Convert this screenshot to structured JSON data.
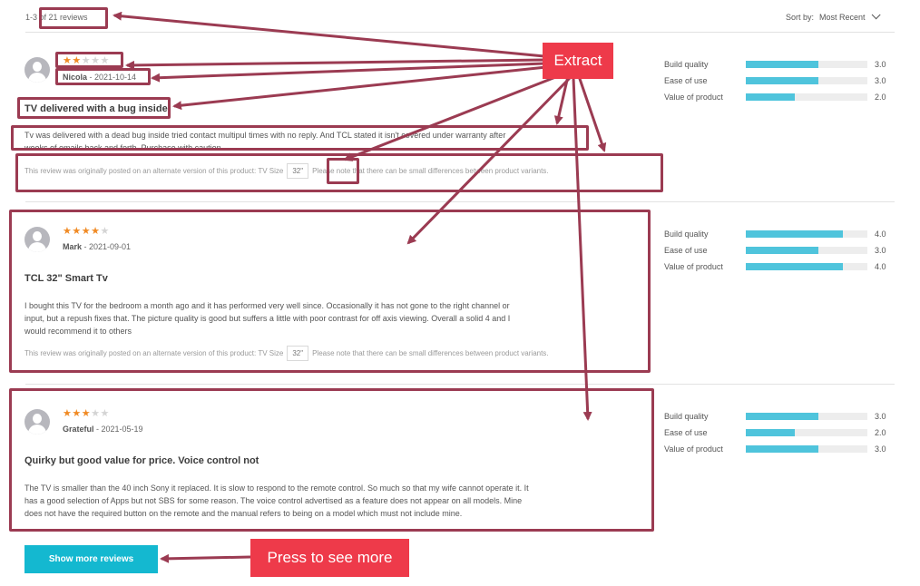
{
  "header": {
    "count": "1-3 of 21 reviews",
    "sort_label": "Sort by:",
    "sort_value": "Most Recent"
  },
  "reviews": [
    {
      "stars": 2,
      "author": "Nicola",
      "date": "2021-10-14",
      "title": "TV delivered with a bug inside",
      "text_lines": [
        "Tv was delivered with a dead bug inside tried contact multipul times with no reply. And TCL stated it isn't covered under warranty after",
        "weeks of emails back and forth. Purchase with caution."
      ],
      "variant_prefix": "This review was originally posted on an alternate version of this product: TV Size",
      "variant_size": "32\"",
      "variant_suffix": "Please note that there can be small differences between product variants.",
      "ratings": [
        {
          "label": "Build quality",
          "value": 3.0,
          "display": "3.0"
        },
        {
          "label": "Ease of use",
          "value": 3.0,
          "display": "3.0"
        },
        {
          "label": "Value of product",
          "value": 2.0,
          "display": "2.0"
        }
      ]
    },
    {
      "stars": 4,
      "author": "Mark",
      "date": "2021-09-01",
      "title": "TCL 32\" Smart Tv",
      "text_lines": [
        "I bought this TV for the bedroom a month ago and it has performed very well since. Occasionally it has not gone to the right channel or",
        "input, but a repush fixes that. The picture quality is good but suffers a little with poor contrast for off axis viewing. Overall a solid 4 and I",
        "would recommend it to others"
      ],
      "variant_prefix": "This review was originally posted on an alternate version of this product: TV Size",
      "variant_size": "32\"",
      "variant_suffix": "Please note that there can be small differences between product variants.",
      "ratings": [
        {
          "label": "Build quality",
          "value": 4.0,
          "display": "4.0"
        },
        {
          "label": "Ease of use",
          "value": 3.0,
          "display": "3.0"
        },
        {
          "label": "Value of product",
          "value": 4.0,
          "display": "4.0"
        }
      ]
    },
    {
      "stars": 3,
      "author": "Grateful",
      "date": "2021-05-19",
      "title": "Quirky but good value for price. Voice control not",
      "text_lines": [
        "The TV is smaller than the 40 inch Sony it replaced. It is slow to respond to the remote control. So much so that my wife cannot operate it. It",
        "has a good selection of Apps but not SBS for some reason. The voice control advertised as a feature does not appear on all models. Mine",
        "does not have the required button on the remote and the manual refers to being on a model which must not include mine."
      ],
      "ratings": [
        {
          "label": "Build quality",
          "value": 3.0,
          "display": "3.0"
        },
        {
          "label": "Ease of use",
          "value": 2.0,
          "display": "2.0"
        },
        {
          "label": "Value of product",
          "value": 3.0,
          "display": "3.0"
        }
      ]
    }
  ],
  "rating_max": 5,
  "show_more_label": "Show more reviews",
  "annotations": {
    "extract_label": "Extract",
    "press_label": "Press to see more",
    "callout_color": "#ee3a4a",
    "outline_color": "#9b3b52"
  },
  "colors": {
    "star_on": "#f08a24",
    "star_off": "#d4d4d4",
    "bar_fill": "#4fc4dc",
    "button": "#14b8d0"
  }
}
